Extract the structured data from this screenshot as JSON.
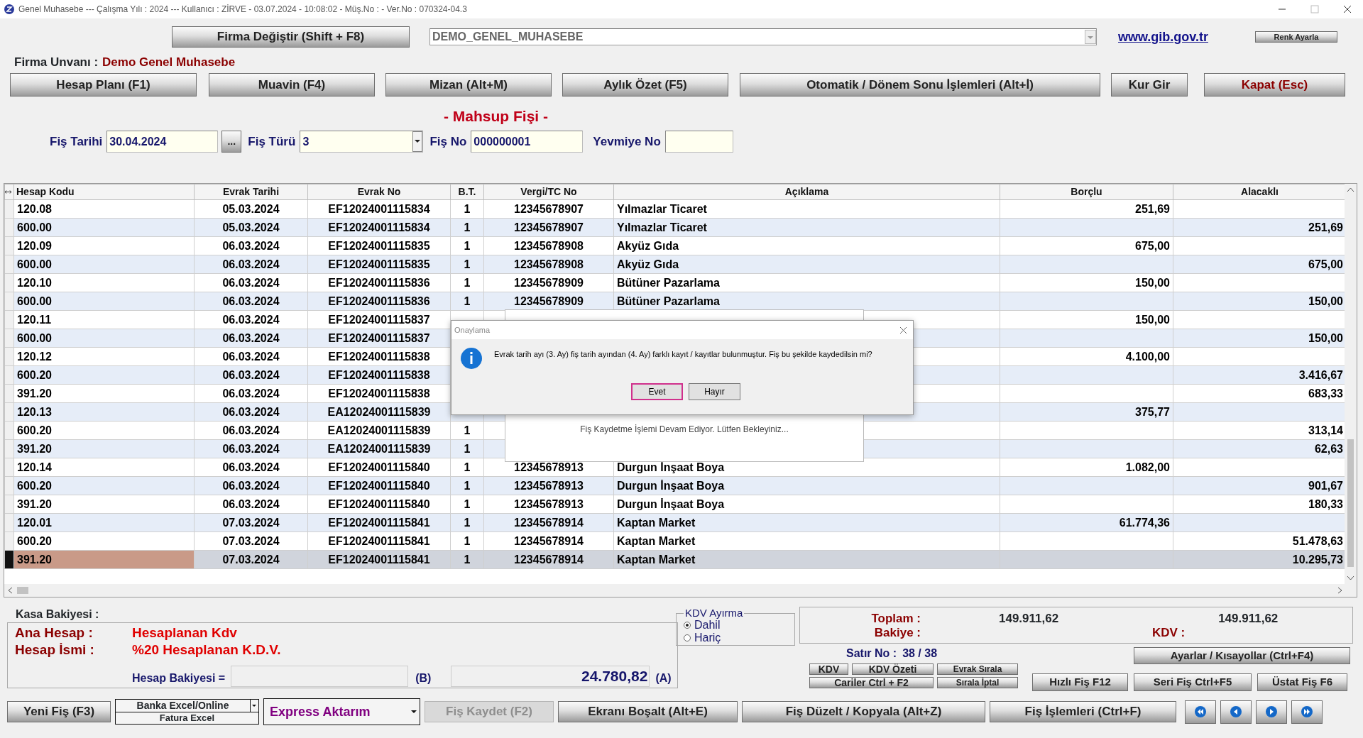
{
  "window": {
    "title": "Genel Muhasebe  ---  Çalışma Yılı : 2024  ---  Kullanıcı : ZİRVE - 03.07.2024 - 10:08:02 - Müş.No :  - Ver.No : 070324-04.3"
  },
  "top_bar": {
    "firma_button": "Firma Değiştir (Shift + F8)",
    "company_select": "DEMO_GENEL_MUHASEBE",
    "link": "www.gib.gov.tr",
    "color_button": "Renk Ayarla"
  },
  "firma_unvani": {
    "label": "Firma Unvanı :",
    "value": "Demo Genel Muhasebe"
  },
  "main_buttons": [
    {
      "label": "Hesap Planı (F1)",
      "kind": "normal"
    },
    {
      "label": "Muavin (F4)",
      "kind": "normal"
    },
    {
      "label": "Mizan (Alt+M)",
      "kind": "normal"
    },
    {
      "label": "Aylık Özet (F5)",
      "kind": "normal"
    },
    {
      "label": "Otomatik / Dönem Sonu İşlemleri (Alt+İ)",
      "kind": "normal"
    },
    {
      "label": "Kur Gir",
      "kind": "normal"
    },
    {
      "label": "Kapat (Esc)",
      "kind": "danger"
    }
  ],
  "form_title": "- Mahsup Fişi -",
  "fields": [
    {
      "label": "Fiş Tarihi",
      "value": "30.04.2024",
      "kind": "date",
      "button": "..."
    },
    {
      "label": "Fiş Türü",
      "value": "3",
      "kind": "select"
    },
    {
      "label": "Fiş No",
      "value": "000000001",
      "kind": "text"
    },
    {
      "label": "Yevmiye No",
      "kind": "text"
    }
  ],
  "table": {
    "columns": [
      "Hesap Kodu",
      "Evrak Tarihi",
      "Evrak No",
      "B.T.",
      "Vergi/TC No",
      "Açıklama",
      "Borçlu",
      "Alacaklı"
    ],
    "rows": [
      {
        "selected": false,
        "cells": [
          "120.08",
          "05.03.2024",
          "EF12024001115834",
          "1",
          "12345678907",
          "Yılmazlar Ticaret",
          "251,69",
          null
        ]
      },
      {
        "selected": false,
        "cells": [
          "600.00",
          "05.03.2024",
          "EF12024001115834",
          "1",
          "12345678907",
          "Yılmazlar Ticaret",
          null,
          "251,69"
        ]
      },
      {
        "selected": false,
        "cells": [
          "120.09",
          "06.03.2024",
          "EF12024001115835",
          "1",
          "12345678908",
          "Akyüz Gıda",
          "675,00",
          null
        ]
      },
      {
        "selected": false,
        "cells": [
          "600.00",
          "06.03.2024",
          "EF12024001115835",
          "1",
          "12345678908",
          "Akyüz Gıda",
          null,
          "675,00"
        ]
      },
      {
        "selected": false,
        "cells": [
          "120.10",
          "06.03.2024",
          "EF12024001115836",
          "1",
          "12345678909",
          "Bütüner Pazarlama",
          "150,00",
          null
        ]
      },
      {
        "selected": false,
        "cells": [
          "600.00",
          "06.03.2024",
          "EF12024001115836",
          "1",
          "12345678909",
          "Bütüner Pazarlama",
          null,
          "150,00"
        ]
      },
      {
        "selected": false,
        "cells": [
          "120.11",
          "06.03.2024",
          "EF12024001115837",
          null,
          null,
          null,
          "150,00",
          null
        ]
      },
      {
        "selected": false,
        "cells": [
          "600.00",
          "06.03.2024",
          "EF12024001115837",
          null,
          null,
          null,
          null,
          "150,00"
        ]
      },
      {
        "selected": false,
        "cells": [
          "120.12",
          "06.03.2024",
          "EF12024001115838",
          null,
          null,
          null,
          "4.100,00",
          null
        ]
      },
      {
        "selected": false,
        "cells": [
          "600.20",
          "06.03.2024",
          "EF12024001115838",
          null,
          null,
          null,
          null,
          "3.416,67"
        ]
      },
      {
        "selected": false,
        "cells": [
          "391.20",
          "06.03.2024",
          "EF12024001115838",
          null,
          null,
          null,
          null,
          "683,33"
        ]
      },
      {
        "selected": false,
        "cells": [
          "120.13",
          "06.03.2024",
          "EA12024001115839",
          null,
          null,
          null,
          "375,77",
          null
        ]
      },
      {
        "selected": false,
        "cells": [
          "600.20",
          "06.03.2024",
          "EA12024001115839",
          "1",
          null,
          null,
          null,
          "313,14"
        ]
      },
      {
        "selected": false,
        "cells": [
          "391.20",
          "06.03.2024",
          "EA12024001115839",
          "1",
          null,
          null,
          null,
          "62,63"
        ]
      },
      {
        "selected": false,
        "cells": [
          "120.14",
          "06.03.2024",
          "EF12024001115840",
          "1",
          "12345678913",
          "Durgun İnşaat Boya",
          "1.082,00",
          null
        ]
      },
      {
        "selected": false,
        "cells": [
          "600.20",
          "06.03.2024",
          "EF12024001115840",
          "1",
          "12345678913",
          "Durgun İnşaat Boya",
          null,
          "901,67"
        ]
      },
      {
        "selected": false,
        "cells": [
          "391.20",
          "06.03.2024",
          "EF12024001115840",
          "1",
          "12345678913",
          "Durgun İnşaat Boya",
          null,
          "180,33"
        ]
      },
      {
        "selected": false,
        "cells": [
          "120.01",
          "07.03.2024",
          "EF12024001115841",
          "1",
          "12345678914",
          "Kaptan Market",
          "61.774,36",
          null
        ]
      },
      {
        "selected": false,
        "cells": [
          "600.20",
          "07.03.2024",
          "EF12024001115841",
          "1",
          "12345678914",
          "Kaptan Market",
          null,
          "51.478,63"
        ]
      },
      {
        "selected": true,
        "cells": [
          "391.20",
          "07.03.2024",
          "EF12024001115841",
          "1",
          "12345678914",
          "Kaptan Market",
          null,
          "10.295,73"
        ]
      }
    ]
  },
  "progress_panel": {
    "message": "Fiş Kaydetme İşlemi Devam Ediyor. Lütfen Bekleyiniz..."
  },
  "dialog": {
    "title": "Onaylama",
    "message": "Evrak tarih ayı (3. Ay) fiş tarih ayından (4. Ay) farklı kayıt / kayıtlar bulunmuştur. Fiş bu şekilde kaydedilsin mi?",
    "buttons": [
      {
        "label": "Evet",
        "selected": true
      },
      {
        "label": "Hayır",
        "selected": false
      }
    ]
  },
  "account_panel": {
    "kasa_label": "Kasa Bakiyesi :",
    "ana_hesap_label": "Ana Hesap :",
    "ana_hesap_value": "Hesaplanan Kdv",
    "hesap_ismi_label": "Hesap İsmi :",
    "hesap_ismi_value": "%20 Hesaplanan K.D.V.",
    "bakiye_label": "Hesap Bakiyesi =",
    "b_label": "(B)",
    "a_value": "24.780,82",
    "a_label": "(A)"
  },
  "kdv_ayirma": {
    "title": "KDV Ayırma",
    "options": [
      {
        "label": "Dahil",
        "selected": true
      },
      {
        "label": "Hariç",
        "selected": false
      }
    ]
  },
  "totals": {
    "toplam_label": "Toplam :",
    "borc_total": "149.911,62",
    "alacak_total": "149.911,62",
    "bakiye_label": "Bakiye :",
    "kdv_label": "KDV :"
  },
  "satir_no": {
    "label": "Satır No :",
    "value": "38 / 38"
  },
  "small_buttons": [
    "KDV",
    "KDV Özeti",
    "Evrak Sırala",
    "Cariler Ctrl + F2",
    "Sırala İptal"
  ],
  "right_buttons": [
    "Ayarlar / Kısayollar (Ctrl+F4)",
    "Hızlı Fiş F12",
    "Seri Fiş Ctrl+F5",
    "Üstat Fiş F6"
  ],
  "bottom_buttons": [
    {
      "label": "Yeni Fiş (F3)",
      "kind": "button",
      "disabled": false
    },
    {
      "label": "Banka Excel/Online",
      "label2": "Fatura Excel",
      "kind": "stack",
      "disabled": false
    },
    {
      "label": "Express Aktarım",
      "kind": "dropdown",
      "disabled": false
    },
    {
      "label": "Fiş Kaydet (F2)",
      "kind": "button",
      "disabled": true
    },
    {
      "label": "Ekranı Boşalt (Alt+E)",
      "kind": "button",
      "disabled": false
    },
    {
      "label": "Fiş Düzelt / Kopyala (Alt+Z)",
      "kind": "button",
      "disabled": false
    },
    {
      "label": "Fiş İşlemleri (Ctrl+F)",
      "kind": "button",
      "disabled": false
    },
    {
      "kind": "nav-first",
      "disabled": false
    },
    {
      "kind": "nav-prev",
      "disabled": false
    },
    {
      "kind": "nav-next",
      "disabled": false
    },
    {
      "kind": "nav-last",
      "disabled": false
    }
  ]
}
